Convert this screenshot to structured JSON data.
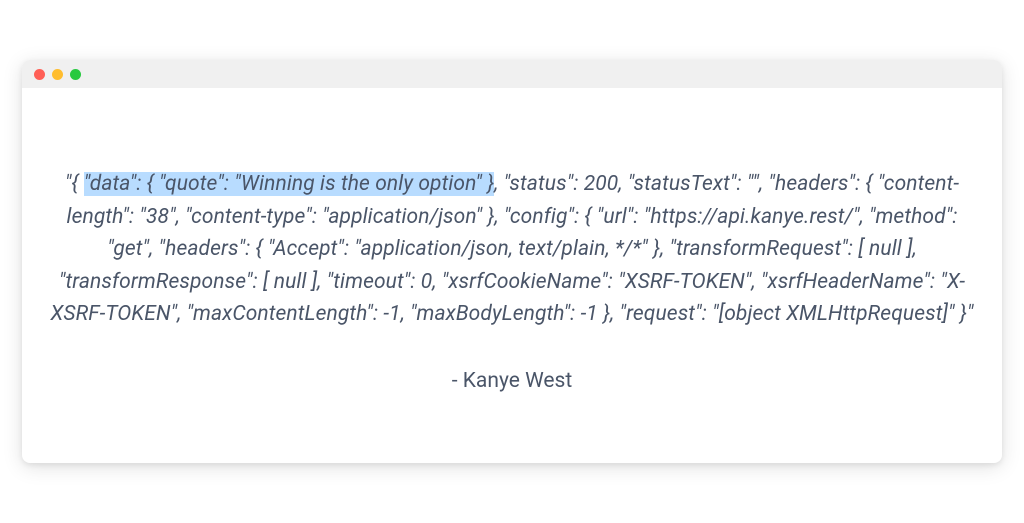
{
  "quote": {
    "prefix": "\"{ ",
    "highlighted": "\"data\": { \"quote\": \"Winning is the only option\" }",
    "suffix": ", \"status\": 200, \"statusText\": \"\", \"headers\": { \"content-length\": \"38\", \"content-type\": \"application/json\" }, \"config\": { \"url\": \"https://api.kanye.rest/\", \"method\": \"get\", \"headers\": { \"Accept\": \"application/json, text/plain, */*\" }, \"transformRequest\": [ null ], \"transformResponse\": [ null ], \"timeout\": 0, \"xsrfCookieName\": \"XSRF-TOKEN\", \"xsrfHeaderName\": \"X-XSRF-TOKEN\", \"maxContentLength\": -1, \"maxBodyLength\": -1 }, \"request\": \"[object XMLHttpRequest]\" }\""
  },
  "attribution": "- Kanye West"
}
